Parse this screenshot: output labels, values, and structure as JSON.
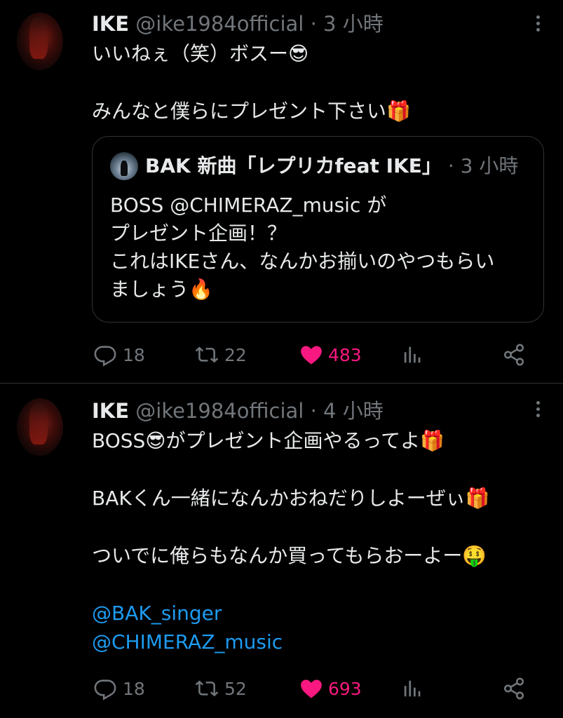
{
  "colors": {
    "background": "#000000",
    "text": "#e7e9ea",
    "muted": "#71767b",
    "like": "#f91880",
    "link": "#1d9bf0",
    "border": "#2f3336"
  },
  "tweets": [
    {
      "name": "IKE",
      "handle": "@ike1984official",
      "separator": "·",
      "time": "3 小時",
      "lines": [
        "いいねぇ（笑）ボスー😎",
        "",
        "みんなと僕らにプレゼント下さい🎁"
      ],
      "quote": {
        "name": "BAK 新曲「レプリカfeat IKE」",
        "separator": "·",
        "time": "3 小時",
        "lines": [
          "BOSS @CHIMERAZ_music が",
          "プレゼント企画！？",
          "これはIKEさん、なんかお揃いのやつもらい",
          "ましょう🔥"
        ]
      },
      "stats": {
        "replies": "18",
        "retweets": "22",
        "likes": "483"
      }
    },
    {
      "name": "IKE",
      "handle": "@ike1984official",
      "separator": "·",
      "time": "4 小時",
      "lines": [
        "BOSS😎がプレゼント企画やるってよ🎁",
        "",
        "BAKくん一緒になんかおねだりしよーぜぃ🎁",
        "",
        "ついでに俺らもなんか買ってもらおーよー🤑",
        ""
      ],
      "mentions": [
        "@BAK_singer",
        "@CHIMERAZ_music"
      ],
      "stats": {
        "replies": "18",
        "retweets": "52",
        "likes": "693"
      }
    }
  ],
  "icons": {
    "reply": "reply-icon",
    "retweet": "retweet-icon",
    "like": "heart-icon",
    "views": "views-icon",
    "share": "share-icon",
    "more": "more-icon"
  }
}
